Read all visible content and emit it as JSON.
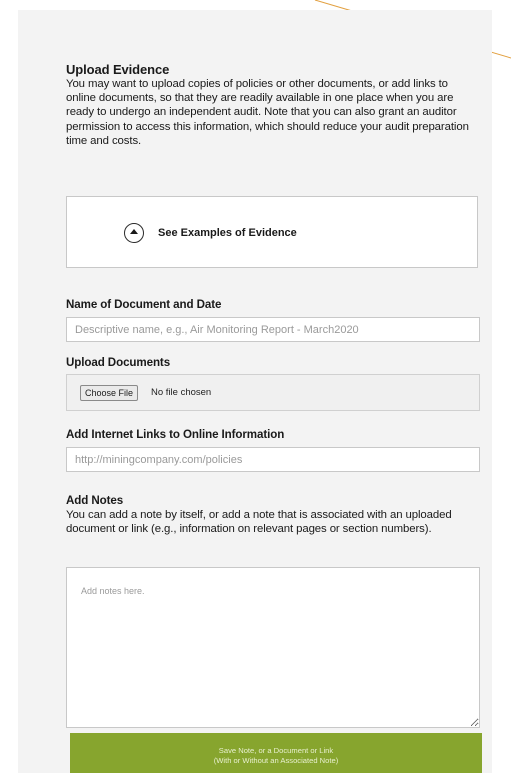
{
  "upload_evidence": {
    "title": "Upload Evidence",
    "description": "You may want to upload copies of policies or other documents, or add links to online documents, so that they are readily available in one place when you are ready to undergo an independent audit. Note that you can also grant an auditor permission to access this information, which should reduce your audit preparation time and costs."
  },
  "examples": {
    "label": "See Examples of Evidence",
    "icon": "chevron-up-circle-icon"
  },
  "document_name": {
    "label": "Name of Document and Date",
    "value": "",
    "placeholder": "Descriptive name, e.g., Air Monitoring Report - March2020"
  },
  "upload_documents": {
    "label": "Upload Documents",
    "button_label": "Choose File",
    "status": "No file chosen"
  },
  "internet_links": {
    "label": "Add Internet Links to Online Information",
    "value": "",
    "placeholder": "http://miningcompany.com/policies"
  },
  "notes": {
    "label": "Add Notes",
    "description": "You can add a note by itself, or add a note that is associated with an uploaded document or link (e.g., information on relevant pages or section numbers).",
    "value": "",
    "placeholder": "Add notes here."
  },
  "save_button": {
    "line1": "Save Note, or a Document or Link",
    "line2": "(With or Without an Associated Note)"
  },
  "colors": {
    "accent_green": "#87a52e",
    "decorative_line": "#e2a040"
  }
}
